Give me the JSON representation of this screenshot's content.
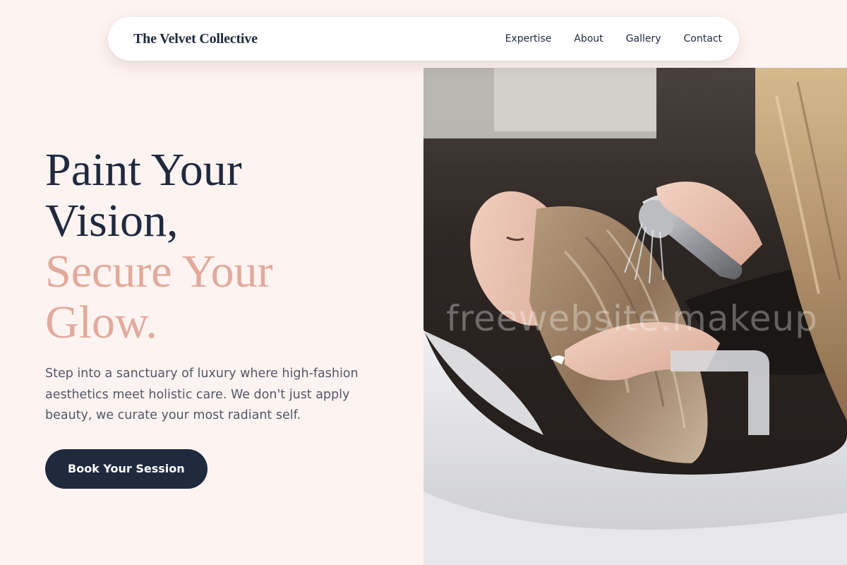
{
  "brand": {
    "name": "The Velvet Collective"
  },
  "nav": {
    "items": [
      {
        "label": "Expertise"
      },
      {
        "label": "About"
      },
      {
        "label": "Gallery"
      },
      {
        "label": "Contact"
      }
    ]
  },
  "hero": {
    "headline_line1": "Paint Your",
    "headline_line2": "Vision,",
    "headline_accent_line1": "Secure Your",
    "headline_accent_line2": "Glow.",
    "description": "Step into a sanctuary of luxury where high-fashion aesthetics meet holistic care. We don't just apply beauty, we curate your most radiant self.",
    "cta_label": "Book Your Session",
    "image_watermark": "freewebsite.makeup"
  },
  "colors": {
    "background": "#fdf3f1",
    "navy": "#1f2a3f",
    "accent_rose": "#e2aa9c",
    "body_text": "#545866"
  }
}
